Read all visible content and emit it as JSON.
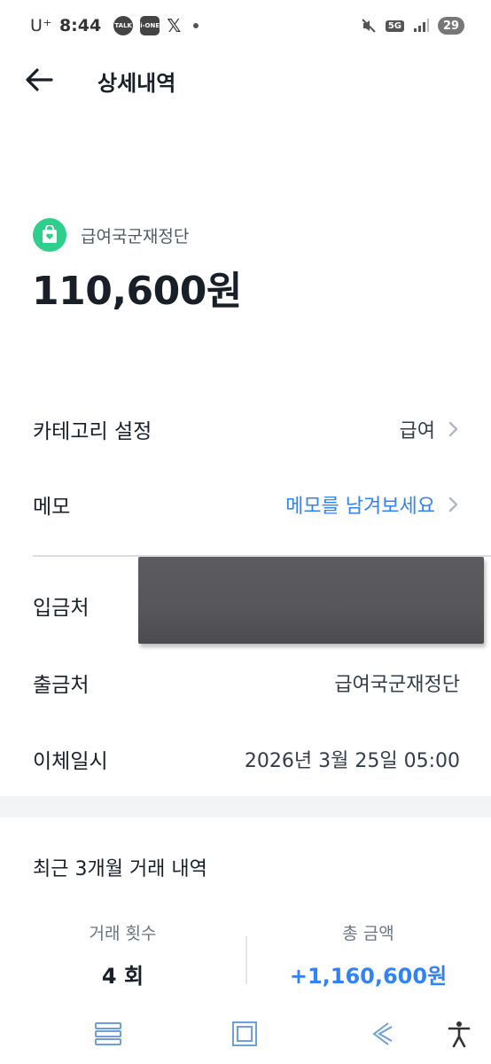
{
  "status_bar": {
    "carrier": "U⁺",
    "time": "8:44",
    "notification_icons": [
      "talk-icon",
      "ione-bank-icon",
      "x-icon"
    ],
    "network": "5G",
    "battery": "29"
  },
  "header": {
    "title": "상세내역"
  },
  "transaction": {
    "payer_name": "급여국군재정단",
    "amount": "110,600원",
    "icon_color": "#2ecf8a"
  },
  "details": {
    "category_label": "카테고리 설정",
    "category_value": "급여",
    "memo_label": "메모",
    "memo_placeholder": "메모를 남겨보세요",
    "deposit_label": "입금처",
    "withdraw_label": "출금처",
    "withdraw_value": "급여국군재정단",
    "datetime_label": "이체일시",
    "datetime_value": "2026년 3월 25일 05:00"
  },
  "recent": {
    "title": "최근 3개월 거래 내역",
    "count_label": "거래 횟수",
    "count_value": "4 회",
    "total_label": "총 금액",
    "total_value": "+1,160,600원"
  },
  "colors": {
    "accent": "#3182f6",
    "text": "#191f28",
    "nav_icon": "#6b9fe0"
  }
}
